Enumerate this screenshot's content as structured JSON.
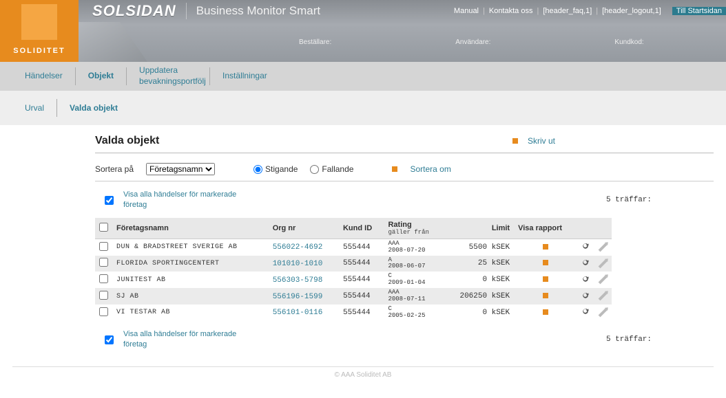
{
  "logo_text": "SOLIDITET",
  "app_title": "SOLSIDAN",
  "app_sub": "Business Monitor Smart",
  "toplinks": {
    "manual": "Manual",
    "contact": "Kontakta oss",
    "faq": "[header_faq,1]",
    "logout": "[header_logout,1]",
    "start": "Till Startsidan"
  },
  "inforow": {
    "orderer_lbl": "Beställare:",
    "user_lbl": "Användare:",
    "cust_lbl": "Kundkod:"
  },
  "mainnav": {
    "events": "Händelser",
    "objects": "Objekt",
    "update": "Uppdatera bevakningsportfölj",
    "settings": "Inställningar"
  },
  "subnav": {
    "urval": "Urval",
    "selected": "Valda objekt"
  },
  "page_title": "Valda objekt",
  "print_label": "Skriv ut",
  "sort": {
    "label": "Sortera på",
    "selected": "Företagsnamn",
    "asc": "Stigande",
    "desc": "Fallande",
    "resort": "Sortera om"
  },
  "show_events_label": "Visa alla händelser för markerade företag",
  "hits": "5 träffar:",
  "columns": {
    "name": "Företagsnamn",
    "orgnr": "Org nr",
    "kund": "Kund ID",
    "rating": "Rating",
    "rating_sub": "gäller från",
    "limit": "Limit",
    "report": "Visa rapport"
  },
  "rows": [
    {
      "name": "DUN & BRADSTREET SVERIGE AB",
      "org": "556022-4692",
      "kund": "555444",
      "rating": "AAA",
      "date": "2008-07-20",
      "limit": "5500 kSEK"
    },
    {
      "name": "FLORIDA SPORTINGCENTERT",
      "org": "101010-1010",
      "kund": "555444",
      "rating": "A",
      "date": "2008-06-07",
      "limit": "25 kSEK"
    },
    {
      "name": "JUNITEST AB",
      "org": "556303-5798",
      "kund": "555444",
      "rating": "C",
      "date": "2009-01-04",
      "limit": "0 kSEK"
    },
    {
      "name": "SJ AB",
      "org": "556196-1599",
      "kund": "555444",
      "rating": "AAA",
      "date": "2008-07-11",
      "limit": "206250 kSEK"
    },
    {
      "name": "VI TESTAR AB",
      "org": "556101-0116",
      "kund": "555444",
      "rating": "C",
      "date": "2005-02-25",
      "limit": "0 kSEK"
    }
  ],
  "footer": "© AAA Soliditet AB"
}
